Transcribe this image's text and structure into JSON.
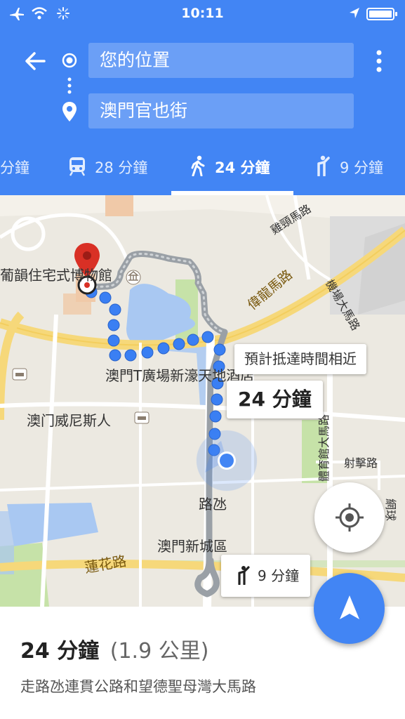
{
  "status_bar": {
    "time": "10:11"
  },
  "header": {
    "origin": "您的位置",
    "destination": "澳門官也街"
  },
  "tabs": [
    {
      "label": "分鐘",
      "icon": "car-icon"
    },
    {
      "label": "28 分鐘",
      "icon": "train-icon"
    },
    {
      "label": "24 分鐘",
      "icon": "walk-icon"
    },
    {
      "label": "9 分鐘",
      "icon": "ride-hail-icon"
    }
  ],
  "map": {
    "labels": {
      "museum": "葡韻住宅式博物館",
      "t_plaza": "澳門T廣場新濠天地酒店",
      "venetian": "澳门威尼斯人",
      "kai_tong": "雞頸馬路",
      "wai_long": "偉龍馬路",
      "airport": "機場大馬路",
      "she_kai": "射擊路",
      "tai_yuk": "體育館大馬路",
      "estrada": "路氹",
      "new_city": "澳門新城區",
      "lin_fa": "蓮花路",
      "network": "網球"
    },
    "callout_similar": "預計抵達時間相近",
    "callout_duration": "24 分鐘",
    "callout_ride": "9 分鐘"
  },
  "sheet": {
    "duration": "24 分鐘",
    "distance": "(1.9 公里)",
    "description": "走路氹連貫公路和望德聖母灣大馬路"
  },
  "colors": {
    "primary": "#4285f4",
    "route_dots": "#3a7ff3",
    "alt_route": "#9aa0a6",
    "pin": "#d93025"
  }
}
